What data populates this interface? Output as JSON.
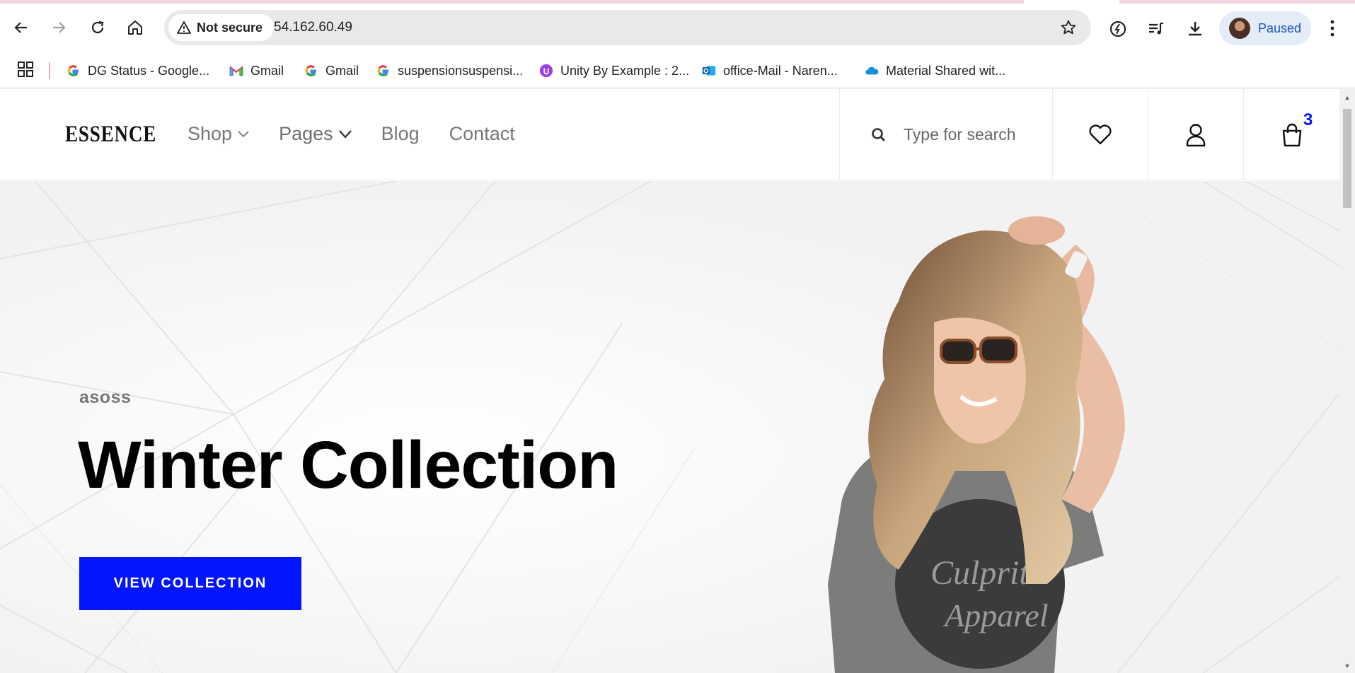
{
  "browser": {
    "security_label": "Not secure",
    "url": "54.162.60.49",
    "profile_label": "Paused",
    "bookmarks": [
      {
        "label": "DG Status - Google...",
        "icon": "google-g-icon"
      },
      {
        "label": "Gmail",
        "icon": "gmail-icon"
      },
      {
        "label": "Gmail",
        "icon": "google-g-icon"
      },
      {
        "label": "suspensionsuspensi...",
        "icon": "google-g-icon"
      },
      {
        "label": "Unity By Example : 2...",
        "icon": "unity-icon"
      },
      {
        "label": "office-Mail - Naren...",
        "icon": "outlook-icon"
      },
      {
        "label": "Material Shared wit...",
        "icon": "onedrive-icon"
      }
    ]
  },
  "site": {
    "logo": "ESSENCE",
    "nav": [
      {
        "label": "Shop",
        "has_dropdown": true
      },
      {
        "label": "Pages",
        "has_dropdown": true
      },
      {
        "label": "Blog",
        "has_dropdown": false
      },
      {
        "label": "Contact",
        "has_dropdown": false
      }
    ],
    "search_placeholder": "Type for search",
    "cart_count": "3",
    "accent_color": "#0315ff"
  },
  "hero": {
    "brand": "asoss",
    "title": "Winter Collection",
    "cta_label": "VIEW COLLECTION"
  }
}
